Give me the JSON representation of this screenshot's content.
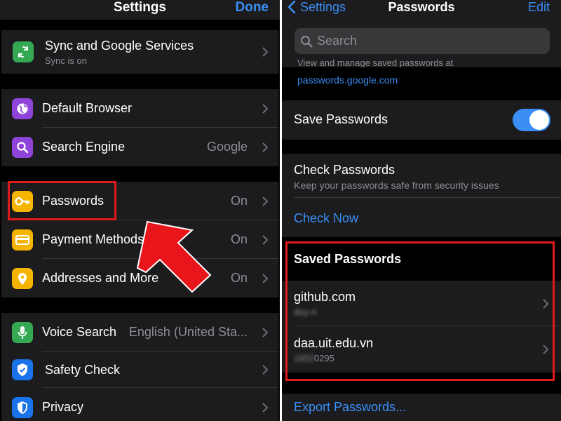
{
  "settings": {
    "title": "Settings",
    "done": "Done",
    "sync": {
      "label": "Sync and Google Services",
      "sub": "Sync is on"
    },
    "items": [
      {
        "label": "Default Browser",
        "value": ""
      },
      {
        "label": "Search Engine",
        "value": "Google"
      },
      {
        "label": "Passwords",
        "value": "On"
      },
      {
        "label": "Payment Methods",
        "value": "On"
      },
      {
        "label": "Addresses and More",
        "value": "On"
      },
      {
        "label": "Voice Search",
        "value": "English (United Sta..."
      },
      {
        "label": "Safety Check",
        "value": ""
      },
      {
        "label": "Privacy",
        "value": ""
      }
    ]
  },
  "passwords": {
    "back": "Settings",
    "title": "Passwords",
    "edit": "Edit",
    "search_placeholder": "Search",
    "info_line": "View and manage saved passwords at",
    "info_link": "passwords.google.com",
    "save_label": "Save Passwords",
    "save_enabled": true,
    "check_title": "Check Passwords",
    "check_sub": "Keep your passwords safe from security issues",
    "check_now": "Check Now",
    "saved_header": "Saved Passwords",
    "saved": [
      {
        "site": "github.com",
        "user": "duy-n"
      },
      {
        "site": "daa.uit.edu.vn",
        "user": "16520295"
      }
    ],
    "export": "Export Passwords..."
  },
  "colors": {
    "accent": "#3a8ef5",
    "highlight": "#e01b1b",
    "arrow": "#e8151b"
  }
}
